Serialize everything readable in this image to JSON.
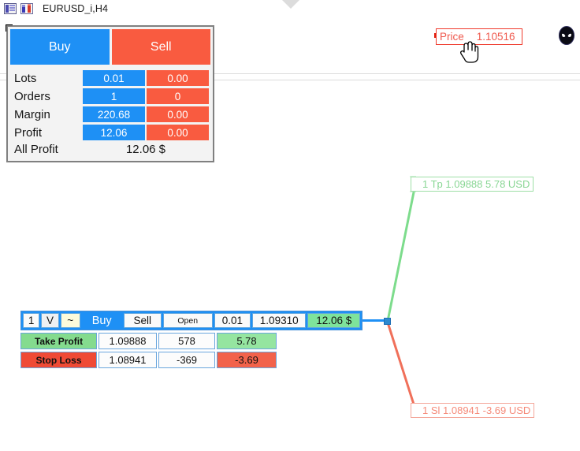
{
  "titlebar": {
    "symbol": "EURUSD_i,H4",
    "icons": [
      "panel-list-icon",
      "chart-bars-icon"
    ]
  },
  "colors": {
    "buy_blue": "#1e90f5",
    "sell_red": "#f95b40",
    "profit_green": "#7ee39b",
    "loss_red": "#ef4a35",
    "tp_line_green": "#7ddc8c",
    "sl_line_red": "#f0705a",
    "price_label_red": "#ef5a4e",
    "grid_grey": "#dcdcdc"
  },
  "panel": {
    "buy_button": "Buy",
    "sell_button": "Sell",
    "rows": [
      {
        "label": "Lots",
        "buy": "0.01",
        "sell": "0.00"
      },
      {
        "label": "Orders",
        "buy": "1",
        "sell": "0"
      },
      {
        "label": "Margin",
        "buy": "220.68",
        "sell": "0.00"
      },
      {
        "label": "Profit",
        "buy": "12.06",
        "sell": "0.00"
      }
    ],
    "all_profit_label": "All Profit",
    "all_profit_value": "12.06 $"
  },
  "price_marker": {
    "label": "Price",
    "value": "1.10516"
  },
  "chart_labels": {
    "take_profit": "1 Tp 1.09888 5.78 USD",
    "stop_loss": "1 Sl 1.08941 -3.69 USD"
  },
  "order": {
    "index": "1",
    "volume_flag": "V",
    "trail_flag": "~",
    "buy_label": "Buy",
    "sell_label": "Sell",
    "type_label": "Open",
    "lots": "0.01",
    "open_price": "1.09310",
    "profit": "12.06 $",
    "take_profit": {
      "name": "Take Profit",
      "price": "1.09888",
      "points": "578",
      "money": "5.78"
    },
    "stop_loss": {
      "name": "Stop Loss",
      "price": "1.08941",
      "points": "-369",
      "money": "-3.69"
    }
  },
  "misc": {
    "alien_icon": "alien-head-icon",
    "cursor_icon": "hand-pointer-cursor",
    "chevron_icon": "chevron-down-icon"
  }
}
